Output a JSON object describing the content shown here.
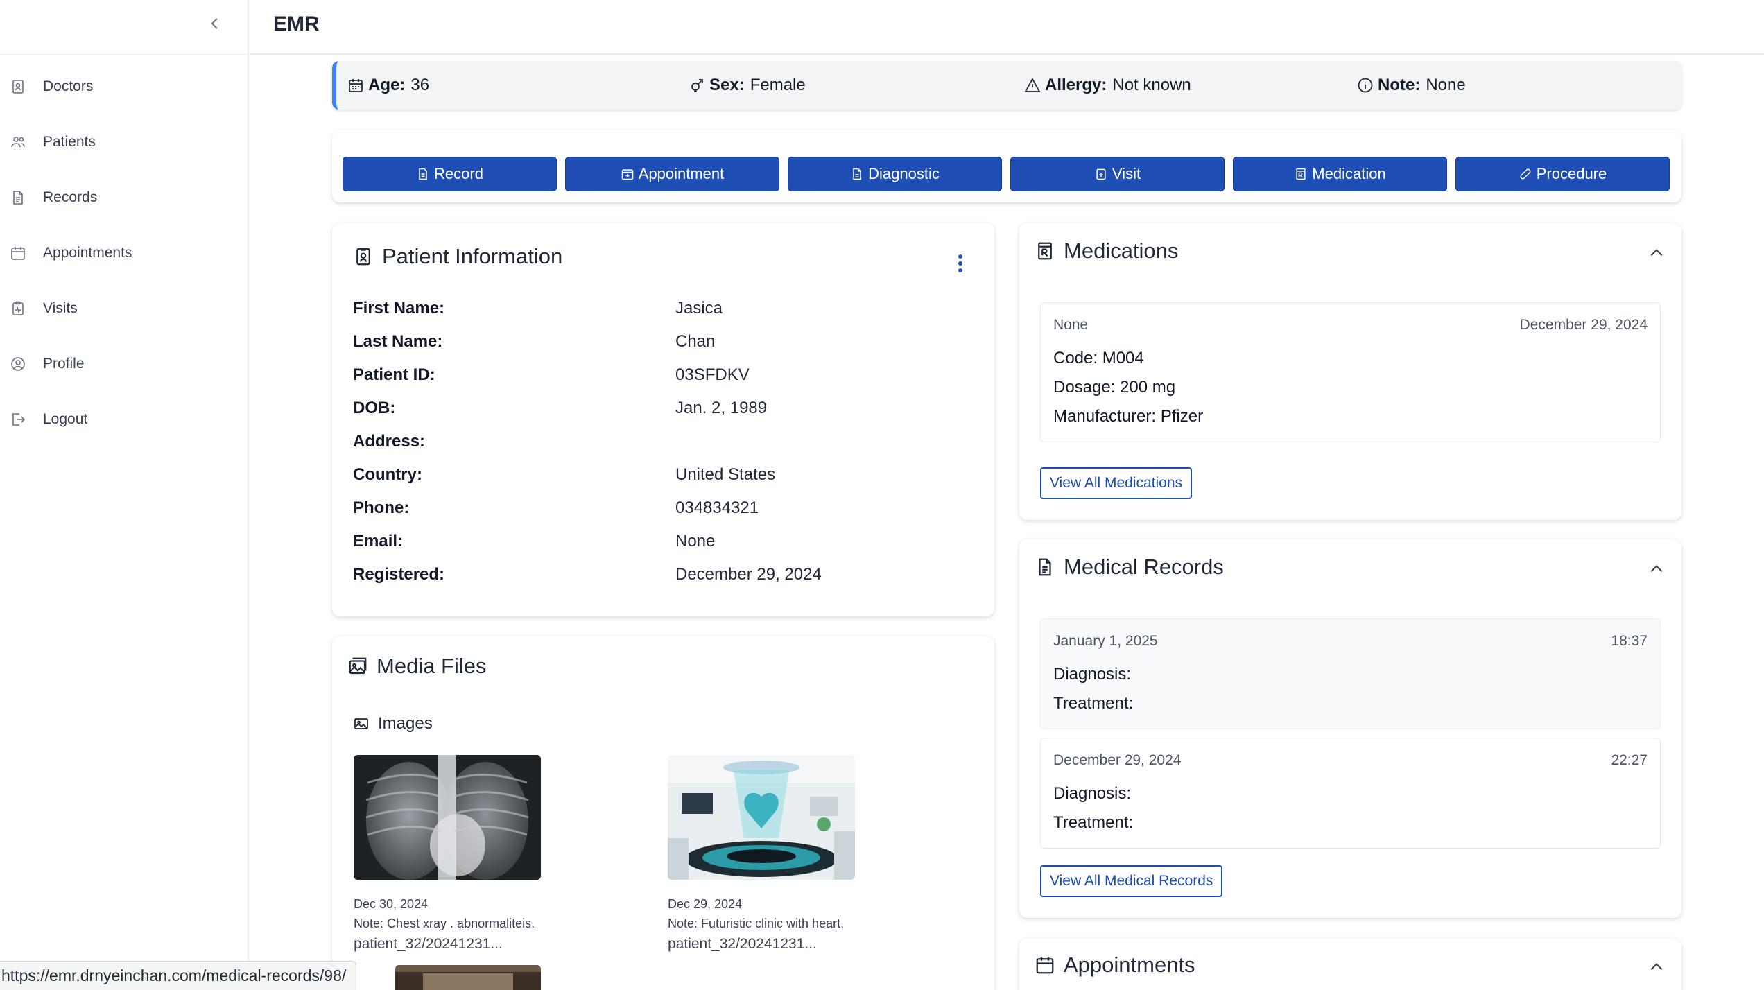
{
  "app": {
    "title": "EMR"
  },
  "sidebar": {
    "items": [
      {
        "label": "Doctors",
        "icon": "doctor-badge-icon"
      },
      {
        "label": "Patients",
        "icon": "users-icon"
      },
      {
        "label": "Records",
        "icon": "document-icon"
      },
      {
        "label": "Appointments",
        "icon": "calendar-icon"
      },
      {
        "label": "Visits",
        "icon": "clipboard-pulse-icon"
      },
      {
        "label": "Profile",
        "icon": "user-circle-icon"
      },
      {
        "label": "Logout",
        "icon": "logout-icon"
      }
    ]
  },
  "summary": {
    "age_label": "Age:",
    "age_value": "36",
    "sex_label": "Sex:",
    "sex_value": "Female",
    "allergy_label": "Allergy:",
    "allergy_value": "Not known",
    "note_label": "Note:",
    "note_value": "None"
  },
  "actions": [
    "Record",
    "Appointment",
    "Diagnostic",
    "Visit",
    "Medication",
    "Procedure"
  ],
  "patient_info": {
    "title": "Patient Information",
    "fields": [
      {
        "label": "First Name:",
        "value": "Jasica"
      },
      {
        "label": "Last Name:",
        "value": "Chan"
      },
      {
        "label": "Patient ID:",
        "value": "03SFDKV"
      },
      {
        "label": "DOB:",
        "value": "Jan. 2, 1989"
      },
      {
        "label": "Address:",
        "value": ""
      },
      {
        "label": "Country:",
        "value": "United States"
      },
      {
        "label": "Phone:",
        "value": "034834321"
      },
      {
        "label": "Email:",
        "value": "None"
      },
      {
        "label": "Registered:",
        "value": "December 29, 2024"
      }
    ]
  },
  "media_files": {
    "title": "Media Files",
    "images_label": "Images",
    "items": [
      {
        "date": "Dec 30, 2024",
        "note": "Note: Chest xray . abnormaliteis.",
        "file": "patient_32/20241231..."
      },
      {
        "date": "Dec 29, 2024",
        "note": "Note: Futuristic clinic with heart.",
        "file": "patient_32/20241231..."
      }
    ]
  },
  "medications": {
    "title": "Medications",
    "items": [
      {
        "name": "None",
        "date": "December 29, 2024",
        "code": "Code: M004",
        "dosage": "Dosage: 200 mg",
        "manufacturer": "Manufacturer: Pfizer"
      }
    ],
    "view_all": "View All Medications"
  },
  "medical_records": {
    "title": "Medical Records",
    "items": [
      {
        "date": "January 1, 2025",
        "time": "18:37",
        "diagnosis": "Diagnosis:",
        "treatment": "Treatment:"
      },
      {
        "date": "December 29, 2024",
        "time": "22:27",
        "diagnosis": "Diagnosis:",
        "treatment": "Treatment:"
      }
    ],
    "view_all": "View All Medical Records"
  },
  "appointments": {
    "title": "Appointments"
  },
  "status_bar": {
    "url": "https://emr.drnyeinchan.com/medical-records/98/"
  },
  "colors": {
    "primary": "#1e4eb3",
    "accent_border": "#3b82f6",
    "infobar_bg": "#f3f4f6"
  }
}
